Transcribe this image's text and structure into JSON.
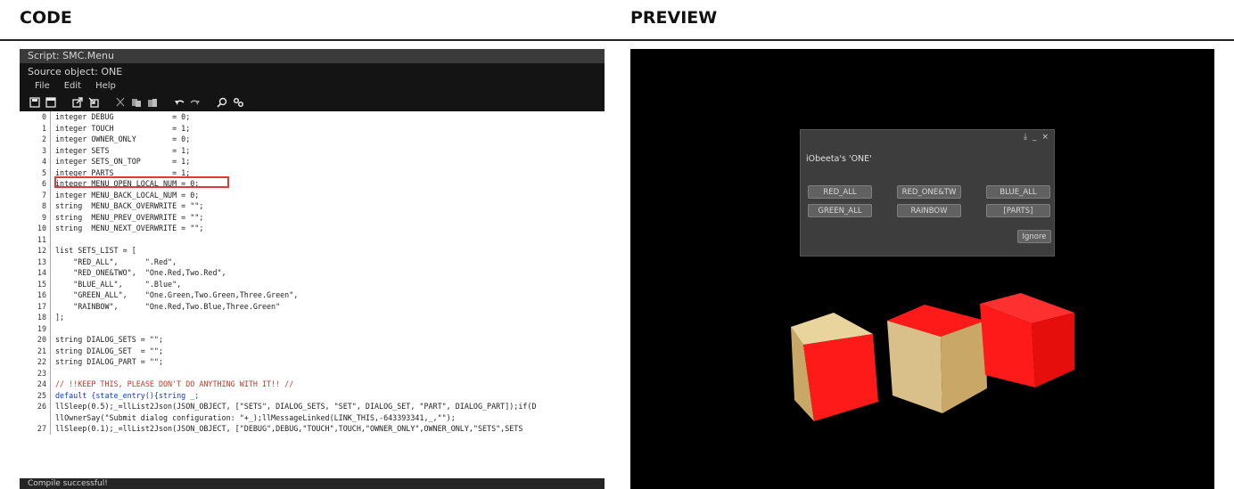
{
  "headings": {
    "code": "CODE",
    "preview": "PREVIEW"
  },
  "editor": {
    "title": "Script: SMC.Menu",
    "source": "Source object: ONE",
    "menu": {
      "file": "File",
      "edit": "Edit",
      "help": "Help"
    },
    "toolbar_icons": [
      "save-icon",
      "save-all-icon",
      "export-icon",
      "import-icon",
      "cut-icon",
      "copy-icon",
      "paste-icon",
      "undo-icon",
      "redo-icon",
      "search-icon",
      "settings-icon"
    ],
    "status": "Compile successful!",
    "lines": [
      {
        "n": "0",
        "t": "integer DEBUG             = 0;"
      },
      {
        "n": "1",
        "t": "integer TOUCH             = 1;"
      },
      {
        "n": "2",
        "t": "integer OWNER_ONLY        = 0;"
      },
      {
        "n": "3",
        "t": "integer SETS              = 1;"
      },
      {
        "n": "4",
        "t": "integer SETS_ON_TOP       = 1;"
      },
      {
        "n": "5",
        "t": "integer PARTS             = 1;"
      },
      {
        "n": "6",
        "t": "integer MENU_OPEN_LOCAL_NUM = 0;"
      },
      {
        "n": "7",
        "t": "integer MENU_BACK_LOCAL_NUM = 0;"
      },
      {
        "n": "8",
        "t": "string  MENU_BACK_OVERWRITE = \"\";"
      },
      {
        "n": "9",
        "t": "string  MENU_PREV_OVERWRITE = \"\";"
      },
      {
        "n": "10",
        "t": "string  MENU_NEXT_OVERWRITE = \"\";"
      },
      {
        "n": "11",
        "t": ""
      },
      {
        "n": "12",
        "t": "list SETS_LIST = ["
      },
      {
        "n": "13",
        "t": "    \"RED_ALL\",      \".Red\","
      },
      {
        "n": "14",
        "t": "    \"RED_ONE&TWO\",  \"One.Red,Two.Red\","
      },
      {
        "n": "15",
        "t": "    \"BLUE_ALL\",     \".Blue\","
      },
      {
        "n": "16",
        "t": "    \"GREEN_ALL\",    \"One.Green,Two.Green,Three.Green\","
      },
      {
        "n": "17",
        "t": "    \"RAINBOW\",      \"One.Red,Two.Blue,Three.Green\""
      },
      {
        "n": "18",
        "t": "];"
      },
      {
        "n": "19",
        "t": ""
      },
      {
        "n": "20",
        "t": "string DIALOG_SETS = \"\";"
      },
      {
        "n": "21",
        "t": "string DIALOG_SET  = \"\";"
      },
      {
        "n": "22",
        "t": "string DIALOG_PART = \"\";"
      },
      {
        "n": "23",
        "t": ""
      },
      {
        "n": "24",
        "t": "// !!KEEP THIS, PLEASE DON'T DO ANYTHING WITH IT!! //"
      },
      {
        "n": "25",
        "t": "default {state_entry(){string _;"
      },
      {
        "n": "26",
        "t": "llSleep(0.5);_=llList2Json(JSON_OBJECT, [\"SETS\", DIALOG_SETS, \"SET\", DIALOG_SET, \"PART\", DIALOG_PART]);if(D"
      },
      {
        "n": "",
        "t": "llOwnerSay(\"Submit dialog configuration: \"+_);llMessageLinked(LINK_THIS,-643393341,_,\"\");"
      },
      {
        "n": "27",
        "t": "llSleep(0.1);_=llList2Json(JSON_OBJECT, [\"DEBUG\",DEBUG,\"TOUCH\",TOUCH,\"OWNER_ONLY\",OWNER_ONLY,\"SETS\",SETS"
      }
    ]
  },
  "dialog": {
    "title": "iObeeta's 'ONE'",
    "buttons": [
      "RED_ALL",
      "RED_ONE&TW",
      "BLUE_ALL",
      "GREEN_ALL",
      "RAINBOW",
      "[PARTS]"
    ],
    "ignore": "Ignore",
    "icons": [
      "download-icon",
      "minimize-icon",
      "close-icon"
    ],
    "icon_glyphs": [
      "⤓",
      "_",
      "×"
    ]
  },
  "colors": {
    "red_face": "#ff1a1a",
    "wood_face": "#d9bf8a",
    "highlight": "#e03b3b"
  }
}
